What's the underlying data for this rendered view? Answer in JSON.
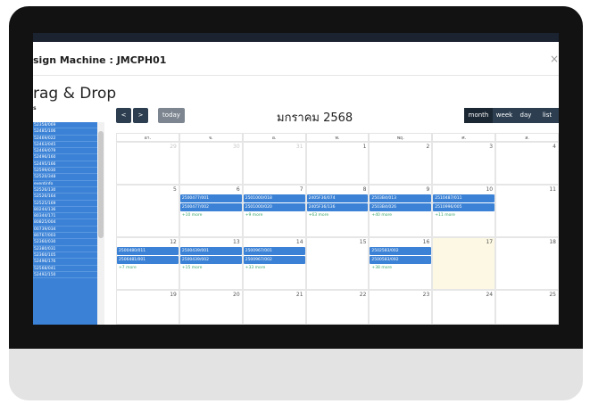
{
  "modal": {
    "title": "sign Machine : JMCPH01",
    "close_icon": "close-icon"
  },
  "external": {
    "title": "rag & Drop",
    "subtitle": "s",
    "items": [
      "52358/069",
      "52485/106",
      "52469/022",
      "52463/045",
      "52469/079",
      "52496/160",
      "52495/166",
      "52599/030",
      "52520/348",
      "eventinfo",
      "52526/130",
      "52526/164",
      "52525/169",
      "80244/136",
      "80344/171",
      "80825/004",
      "00739/034",
      "80767/003",
      "52360/030",
      "52380/031",
      "52360/105",
      "52496/176",
      "52568/041",
      "52492/150"
    ]
  },
  "toolbar": {
    "prev_icon": "chevron-left-icon",
    "next_icon": "chevron-right-icon",
    "prev": "<",
    "next": ">",
    "today": "today",
    "title": "มกราคม 2568",
    "views": [
      "month",
      "week",
      "day",
      "list"
    ],
    "active_view": "month"
  },
  "calendar": {
    "days_of_week": [
      "อา.",
      "จ.",
      "อ.",
      "พ.",
      "พฤ.",
      "ศ.",
      "ส."
    ],
    "weeks": [
      {
        "days": [
          {
            "num": "29",
            "other": true,
            "today": false,
            "events": [],
            "more": ""
          },
          {
            "num": "30",
            "other": true,
            "today": false,
            "events": [],
            "more": ""
          },
          {
            "num": "31",
            "other": true,
            "today": false,
            "events": [],
            "more": ""
          },
          {
            "num": "1",
            "other": false,
            "today": false,
            "events": [],
            "more": ""
          },
          {
            "num": "2",
            "other": false,
            "today": false,
            "events": [],
            "more": ""
          },
          {
            "num": "3",
            "other": false,
            "today": false,
            "events": [],
            "more": ""
          },
          {
            "num": "4",
            "other": false,
            "today": false,
            "events": [],
            "more": ""
          }
        ]
      },
      {
        "days": [
          {
            "num": "5",
            "other": false,
            "today": false,
            "events": [],
            "more": ""
          },
          {
            "num": "6",
            "other": false,
            "today": false,
            "events": [
              "2500477/001",
              "2500477/002"
            ],
            "more": "+10 more"
          },
          {
            "num": "7",
            "other": false,
            "today": false,
            "events": [
              "2501000/018",
              "2501000/020"
            ],
            "more": "+9 more"
          },
          {
            "num": "8",
            "other": false,
            "today": false,
            "events": [
              "2405F36/074",
              "2405F36/136"
            ],
            "more": "+63 more"
          },
          {
            "num": "9",
            "other": false,
            "today": false,
            "events": [
              "2503B4/013",
              "2503B4/026"
            ],
            "more": "+40 more"
          },
          {
            "num": "10",
            "other": false,
            "today": false,
            "events": [
              "2510487/011",
              "2510996/005"
            ],
            "more": "+11 more"
          },
          {
            "num": "11",
            "other": false,
            "today": false,
            "events": [],
            "more": ""
          }
        ]
      },
      {
        "days": [
          {
            "num": "12",
            "other": false,
            "today": false,
            "events": [
              "2500480/011",
              "2506481/001"
            ],
            "more": "+7 more"
          },
          {
            "num": "13",
            "other": false,
            "today": false,
            "events": [
              "2500439/001",
              "2500439/002"
            ],
            "more": "+15 more"
          },
          {
            "num": "14",
            "other": false,
            "today": false,
            "events": [
              "2500967/001",
              "2500967/002"
            ],
            "more": "+33 more"
          },
          {
            "num": "15",
            "other": false,
            "today": false,
            "events": [],
            "more": ""
          },
          {
            "num": "16",
            "other": false,
            "today": false,
            "events": [
              "2502583/002",
              "2500583/092"
            ],
            "more": "+38 more"
          },
          {
            "num": "17",
            "other": false,
            "today": true,
            "events": [],
            "more": ""
          },
          {
            "num": "18",
            "other": false,
            "today": false,
            "events": [],
            "more": ""
          }
        ]
      },
      {
        "days": [
          {
            "num": "19",
            "other": false,
            "today": false,
            "events": [],
            "more": ""
          },
          {
            "num": "20",
            "other": false,
            "today": false,
            "events": [],
            "more": ""
          },
          {
            "num": "21",
            "other": false,
            "today": false,
            "events": [],
            "more": ""
          },
          {
            "num": "22",
            "other": false,
            "today": false,
            "events": [],
            "more": ""
          },
          {
            "num": "23",
            "other": false,
            "today": false,
            "events": [],
            "more": ""
          },
          {
            "num": "24",
            "other": false,
            "today": false,
            "events": [],
            "more": ""
          },
          {
            "num": "25",
            "other": false,
            "today": false,
            "events": [],
            "more": ""
          }
        ]
      }
    ]
  },
  "colors": {
    "event": "#3b82d6",
    "toolbar_button": "#2c3e50",
    "today_cell": "#fcf8e3",
    "more_link": "#3aa66a",
    "frame": "#121212"
  }
}
